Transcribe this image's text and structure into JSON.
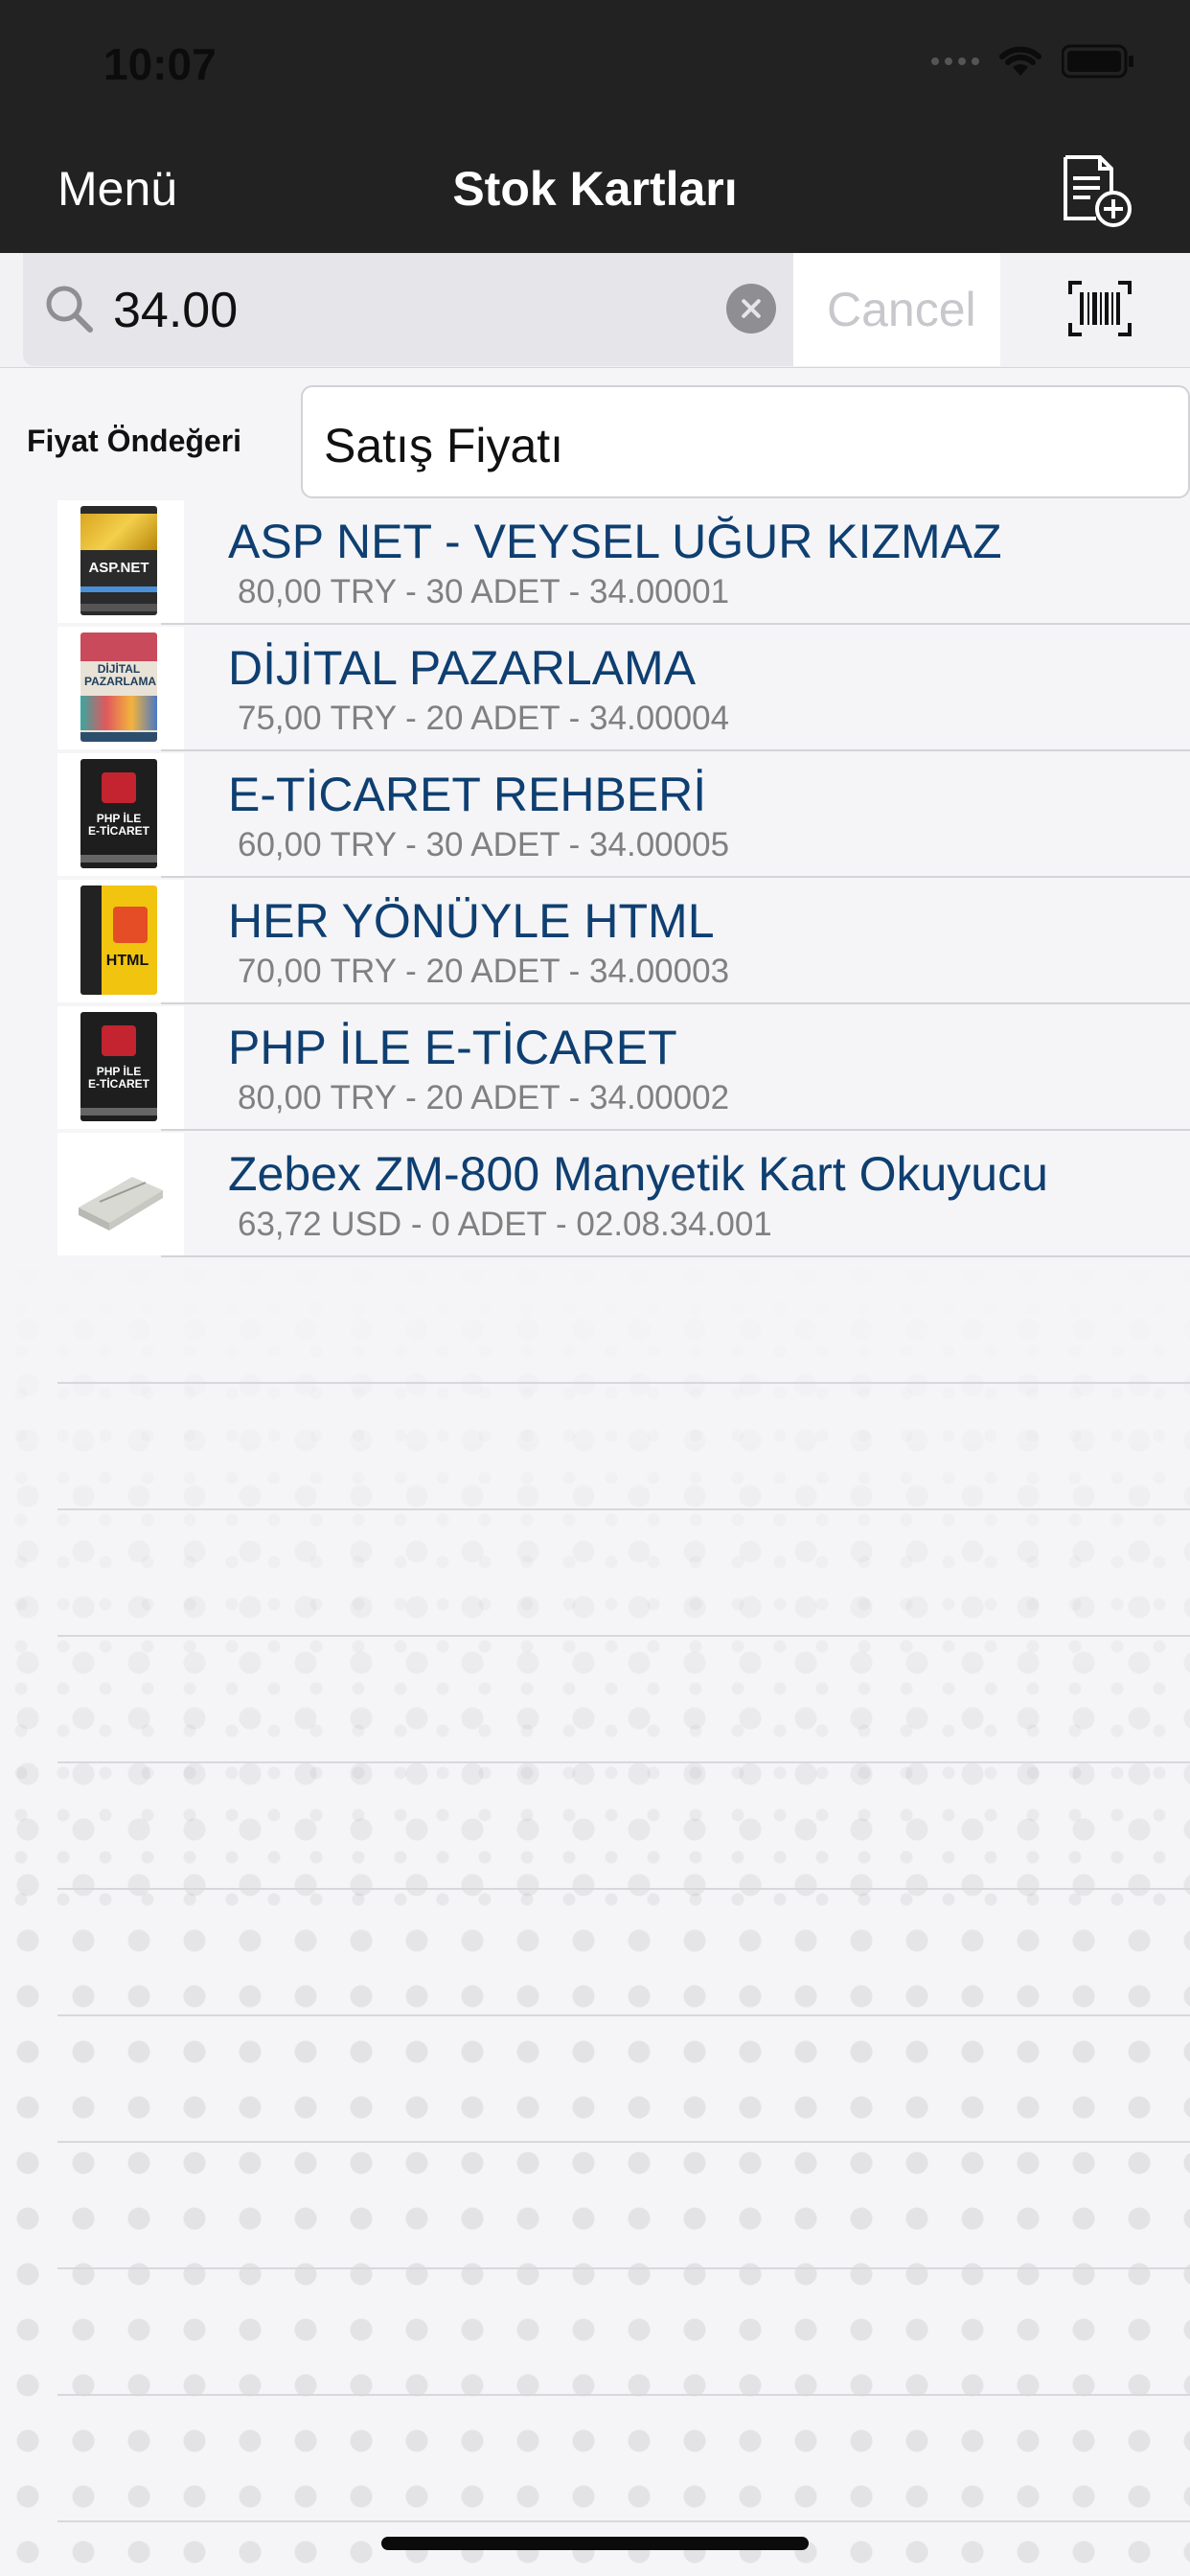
{
  "status_bar": {
    "time": "10:07"
  },
  "nav": {
    "menu_label": "Menü",
    "title": "Stok Kartları"
  },
  "search": {
    "value": "34.00",
    "cancel_label": "Cancel"
  },
  "price_default": {
    "label": "Fiyat Öndeğeri",
    "value": "Satış Fiyatı"
  },
  "items": [
    {
      "title": "ASP NET - VEYSEL UĞUR KIZMAZ",
      "subtitle": "80,00 TRY  -  30 ADET - 34.00001",
      "thumb_icon": "aspnet-book-icon"
    },
    {
      "title": "DİJİTAL PAZARLAMA",
      "subtitle": "75,00 TRY  -  20 ADET - 34.00004",
      "thumb_icon": "dijital-pazarlama-book-icon"
    },
    {
      "title": "E-TİCARET REHBERİ",
      "subtitle": "60,00 TRY  -  30 ADET - 34.00005",
      "thumb_icon": "eticaret-book-icon"
    },
    {
      "title": "HER YÖNÜYLE HTML",
      "subtitle": "70,00 TRY  -  20 ADET - 34.00003",
      "thumb_icon": "html-book-icon"
    },
    {
      "title": "PHP İLE E-TİCARET",
      "subtitle": "80,00 TRY  -  20 ADET - 34.00002",
      "thumb_icon": "php-book-icon"
    },
    {
      "title": "Zebex ZM-800 Manyetik Kart Okuyucu",
      "subtitle": "63,72 USD  -  0 ADET - 02.08.34.001",
      "thumb_icon": "card-reader-icon"
    }
  ],
  "colors": {
    "nav_bg": "#222222",
    "item_title": "#0f3f71",
    "item_subtitle": "#808080"
  }
}
